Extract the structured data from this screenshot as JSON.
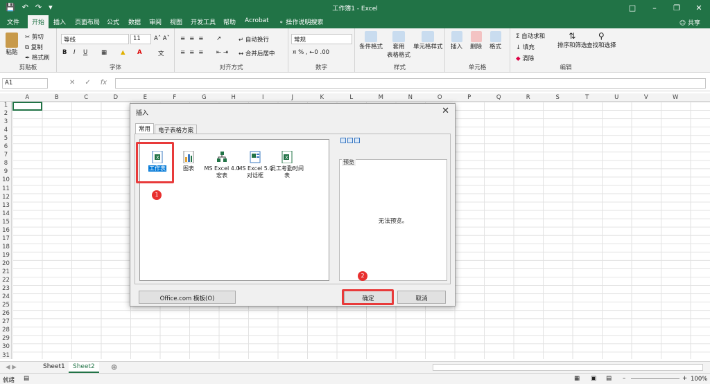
{
  "window": {
    "title": "工作簿1  -  Excel"
  },
  "tabs": [
    "文件",
    "开始",
    "插入",
    "页面布局",
    "公式",
    "数据",
    "审阅",
    "视图",
    "开发工具",
    "帮助",
    "Acrobat"
  ],
  "tell_me": "操作说明搜索",
  "share": "共享",
  "ribbon": {
    "clipboard": {
      "paste": "粘贴",
      "cut": "剪切",
      "copy": "复制",
      "format_painter": "格式刷",
      "label": "剪贴板"
    },
    "font": {
      "name": "等线",
      "size": "11",
      "label": "字体"
    },
    "alignment": {
      "wrap": "自动换行",
      "merge": "合并后居中",
      "label": "对齐方式"
    },
    "number": {
      "format": "常规",
      "label": "数字"
    },
    "styles": {
      "conditional": "条件格式",
      "table_line1": "套用",
      "table_line2": "表格格式",
      "cell_styles": "单元格样式",
      "label": "样式"
    },
    "cells": {
      "insert": "插入",
      "delete": "删除",
      "format": "格式",
      "label": "单元格"
    },
    "editing": {
      "autosum": "自动求和",
      "fill": "填充",
      "clear": "清除",
      "sort": "排序和筛选",
      "find": "查找和选择",
      "label": "编辑"
    }
  },
  "formula_bar": {
    "name_box": "A1"
  },
  "columns": [
    "A",
    "B",
    "C",
    "D",
    "E",
    "F",
    "G",
    "H",
    "I",
    "J",
    "K",
    "L",
    "M",
    "N",
    "O",
    "P",
    "Q",
    "R",
    "S",
    "T",
    "U",
    "V",
    "W"
  ],
  "rows": [
    "1",
    "2",
    "3",
    "4",
    "5",
    "6",
    "7",
    "8",
    "9",
    "10",
    "11",
    "12",
    "13",
    "14",
    "15",
    "16",
    "17",
    "18",
    "19",
    "20",
    "21",
    "22",
    "23",
    "24",
    "25",
    "26",
    "27",
    "28",
    "29",
    "30",
    "31"
  ],
  "sheets": [
    "Sheet1",
    "Sheet2"
  ],
  "status": {
    "ready": "就绪",
    "zoom": "100%"
  },
  "dialog": {
    "title": "插入",
    "tabs": [
      "常用",
      "电子表格方案"
    ],
    "items": [
      "工作表",
      "图表",
      "MS Excel 4.0 宏表",
      "MS Excel 5.0 对话框",
      "员工考勤时间表"
    ],
    "preview_label": "预览",
    "preview_text": "无法预览。",
    "office_button": "Office.com 模板(O)",
    "ok": "确定",
    "cancel": "取消"
  },
  "annotations": {
    "badge1": "1",
    "badge2": "2"
  },
  "colors": {
    "accent": "#217346",
    "highlight": "#e83a3a",
    "selection": "#0078d7"
  }
}
